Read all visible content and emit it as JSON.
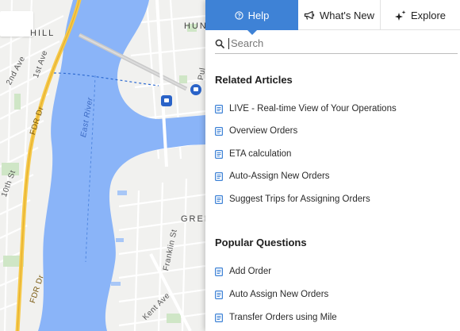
{
  "map": {
    "labels": {
      "hill": "HILL",
      "hun": "HUN",
      "second_ave": "2nd Ave",
      "first_ave": "1st Ave",
      "east_river": "East River",
      "fdr_dr_top": "FDR Dr",
      "tenth_st": "10th St",
      "green": "GREE",
      "franklin_st": "Franklin St",
      "kent_ave": "Kent Ave",
      "fdr_dr_bottom": "FDR Dr",
      "pulaski": "Pul"
    },
    "colors": {
      "water": "#8ab4f8",
      "land": "#f3f3f1",
      "highway": "#f6c94a",
      "park": "#c8e2c0"
    }
  },
  "help_panel": {
    "tabs": [
      {
        "label": "Help",
        "icon": "help-circle-icon",
        "active": true
      },
      {
        "label": "What's New",
        "icon": "megaphone-icon",
        "active": false
      },
      {
        "label": "Explore",
        "icon": "sparkle-icon",
        "active": false
      }
    ],
    "search": {
      "placeholder": "Search",
      "value": ""
    },
    "related_articles": {
      "title": "Related Articles",
      "items": [
        "LIVE - Real-time View of Your Operations",
        "Overview Orders",
        "ETA calculation",
        "Auto-Assign New Orders",
        "Suggest Trips for Assigning Orders"
      ]
    },
    "popular_questions": {
      "title": "Popular Questions",
      "items": [
        "Add Order",
        "Auto Assign New Orders",
        "Transfer Orders using Mile"
      ]
    },
    "colors": {
      "accent": "#3e82d6",
      "doc_icon": "#3e82d6"
    }
  }
}
